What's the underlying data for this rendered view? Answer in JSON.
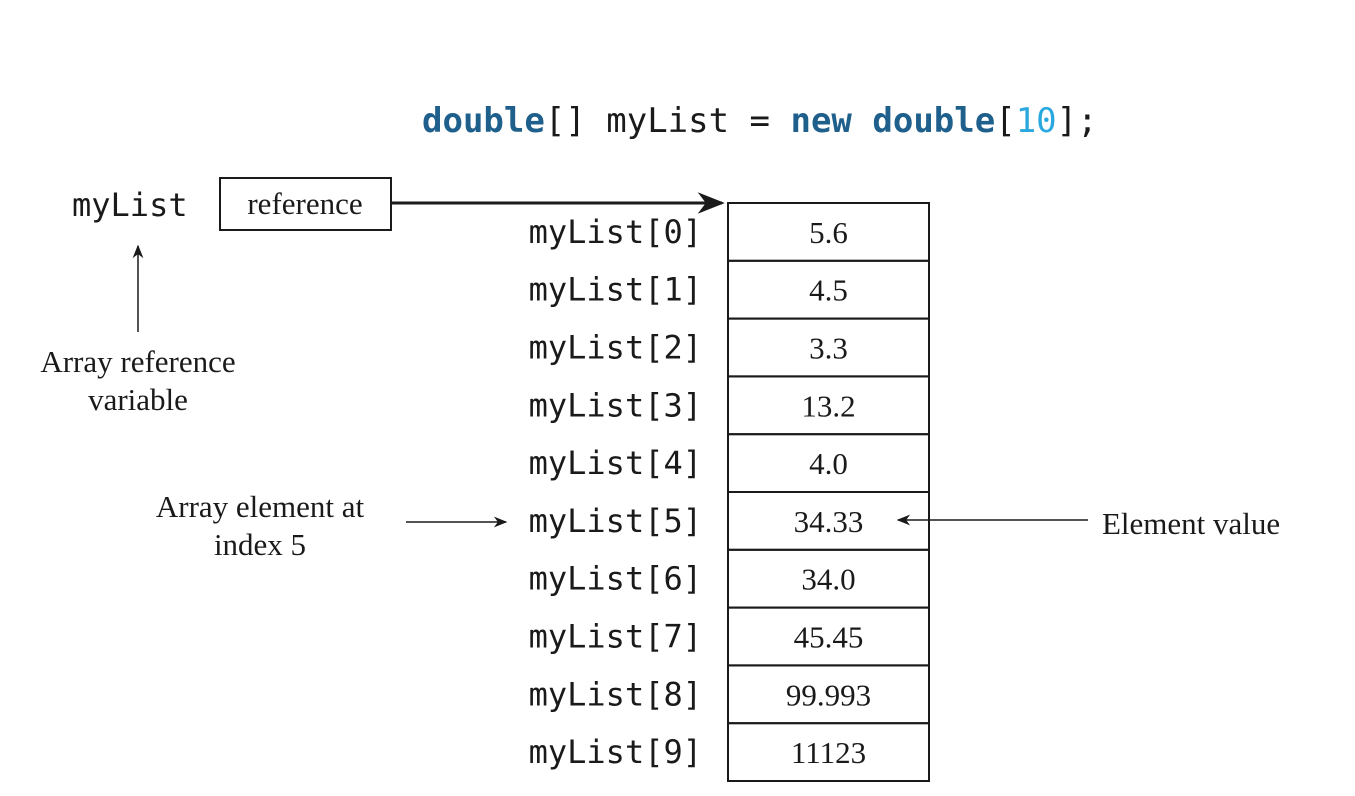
{
  "declaration": {
    "type_keyword": "double",
    "brackets_open": "[]",
    "variable": " myList = ",
    "new_keyword": "new",
    "type_keyword_2": "double",
    "size_open": "[",
    "size": "10",
    "size_close": "];"
  },
  "reference": {
    "variable_label": "myList",
    "box_label": "reference"
  },
  "annotations": {
    "reference_variable_line1": "Array reference",
    "reference_variable_line2": "variable",
    "element_at_line1": "Array element at",
    "element_at_line2": "index 5",
    "element_value": "Element value"
  },
  "array": {
    "index_labels": [
      "myList[0]",
      "myList[1]",
      "myList[2]",
      "myList[3]",
      "myList[4]",
      "myList[5]",
      "myList[6]",
      "myList[7]",
      "myList[8]",
      "myList[9]"
    ],
    "values": [
      "5.6",
      "4.5",
      "3.3",
      "13.2",
      "4.0",
      "34.33",
      "34.0",
      "45.45",
      "99.993",
      "11123"
    ]
  },
  "colors": {
    "keyword": "#1f5f8c",
    "number": "#29a8df",
    "ink": "#1a1a1a"
  }
}
